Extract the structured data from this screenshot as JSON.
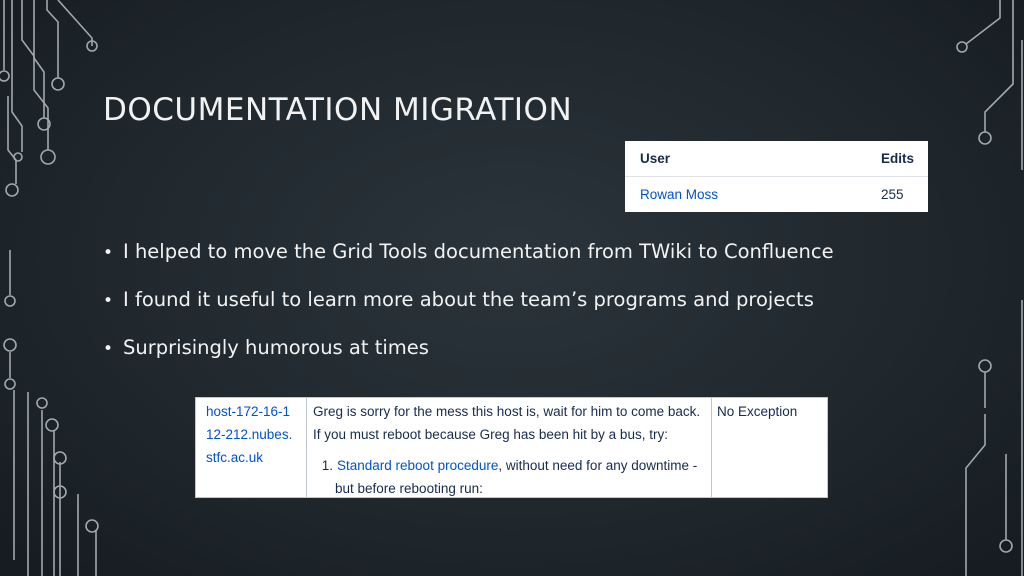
{
  "slide": {
    "title": "DOCUMENTATION MIGRATION",
    "bullets": [
      "I helped to move the Grid Tools documentation from TWiki to Confluence",
      "I found it useful to learn more about the team’s programs and projects",
      "Surprisingly humorous at times"
    ]
  },
  "edits_table": {
    "headers": [
      "User",
      "Edits"
    ],
    "rows": [
      [
        "Rowan Moss",
        "255"
      ]
    ]
  },
  "host_snippet": {
    "host": "host-172-16-112-212.nubes.stfc.ac.uk",
    "message": "Greg is sorry for the mess this host is, wait for him to come back. If you must reboot because Greg has been hit by a bus, try:",
    "step_number": "1.",
    "step_link": "Standard reboot procedure",
    "step_text": ", without need for any downtime -",
    "step_continuation": "but before rebooting run:",
    "exception": "No Exception"
  },
  "colors": {
    "background": "#20282e",
    "circuit": "#b9c0c5",
    "link": "#0052cc"
  }
}
